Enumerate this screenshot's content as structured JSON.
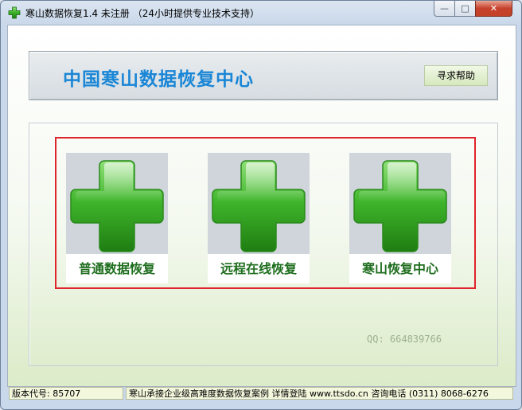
{
  "window": {
    "title": "寒山数据恢复1.4 未注册 （24小时提供专业技术支持）",
    "controls": {
      "minimize": "—",
      "maximize": "□",
      "close": "✕"
    }
  },
  "header": {
    "title": "中国寒山数据恢复中心",
    "help_button": "寻求帮助"
  },
  "tiles": [
    {
      "label": "普通数据恢复",
      "icon": "green-cross-icon"
    },
    {
      "label": "远程在线恢复",
      "icon": "green-cross-icon"
    },
    {
      "label": "寒山恢复中心",
      "icon": "green-cross-icon"
    }
  ],
  "contact": {
    "qq": "QQ: 664839766"
  },
  "statusbar": {
    "version": "版本代号: 85707",
    "info": "寒山承接企业级高难度数据恢复案例 详情登陆 www.ttsdo.cn 咨询电话 (0311) 8068-6276"
  },
  "colors": {
    "title_blue": "#1a86d6",
    "label_green": "#1f6e1f",
    "frame_red": "#e0242b",
    "cross_green": "#34b02a"
  }
}
